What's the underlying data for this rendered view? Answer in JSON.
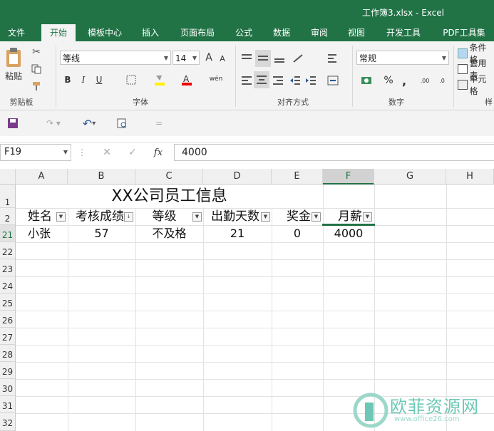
{
  "window": {
    "title": "工作簿3.xlsx - Excel"
  },
  "tabs": [
    "文件",
    "开始",
    "模板中心",
    "插入",
    "页面布局",
    "公式",
    "数据",
    "审阅",
    "视图",
    "开发工具",
    "PDF工具集"
  ],
  "active_tab": "开始",
  "ribbon": {
    "clipboard": {
      "paste": "粘贴",
      "label": "剪贴板"
    },
    "font": {
      "name": "等线",
      "size": "14",
      "bold": "B",
      "italic": "I",
      "underline": "U",
      "label": "字体",
      "grow": "A",
      "shrink": "A",
      "wen": "wén"
    },
    "align": {
      "label": "对齐方式"
    },
    "number": {
      "format": "常规",
      "percent": "%",
      "comma": ",",
      "label": "数字"
    },
    "styles": {
      "cond": "条件格",
      "table": "套用表",
      "cell": "单元格",
      "label": "样"
    }
  },
  "formula": {
    "name_box": "F19",
    "fx": "fx",
    "value": "4000"
  },
  "columns": [
    "A",
    "B",
    "C",
    "D",
    "E",
    "F",
    "G",
    "H"
  ],
  "selected_column": "F",
  "rows": [
    "1",
    "2",
    "21",
    "22",
    "23",
    "24",
    "25",
    "26",
    "27",
    "28",
    "29",
    "30",
    "31",
    "32"
  ],
  "selected_row": "21",
  "sheet": {
    "title": "XX公司员工信息",
    "headers": [
      "姓名",
      "考核成绩",
      "等级",
      "出勤天数",
      "奖金",
      "月薪"
    ],
    "row21": [
      "小张",
      "57",
      "不及格",
      "21",
      "0",
      "4000"
    ]
  },
  "watermark": {
    "text": "欧菲资源网",
    "url": "www.office26.com"
  },
  "colors": {
    "excel_green": "#217346",
    "watermark": "#6cc8b4"
  }
}
